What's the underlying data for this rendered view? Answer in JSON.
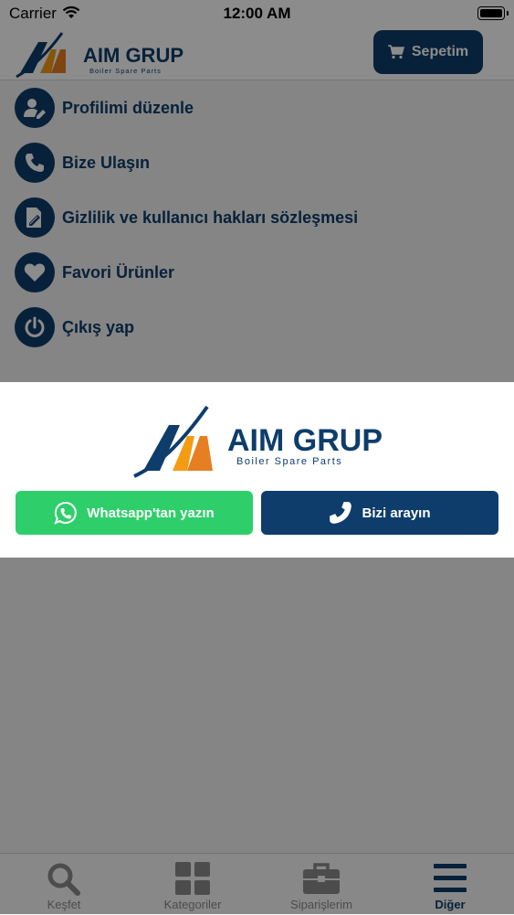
{
  "status_bar": {
    "carrier": "Carrier",
    "time": "12:00 AM"
  },
  "brand": {
    "name": "AIM GRUP",
    "tagline": "Boiler Spare Parts",
    "primary_color": "#0e3d6b",
    "accent_orange": "#f39c12"
  },
  "header": {
    "cart_label": "Sepetim",
    "cart_icon": "cart-icon"
  },
  "menu": {
    "items": [
      {
        "label": "Profilimi düzenle",
        "icon": "user-edit-icon"
      },
      {
        "label": "Bize Ulaşın",
        "icon": "phone-icon"
      },
      {
        "label": "Gizlilik ve kullanıcı hakları sözleşmesi",
        "icon": "document-edit-icon"
      },
      {
        "label": "Favori Ürünler",
        "icon": "heart-icon"
      },
      {
        "label": "Çıkış yap",
        "icon": "power-icon"
      }
    ]
  },
  "modal": {
    "whatsapp_label": "Whatsapp'tan yazın",
    "whatsapp_color": "#2ecf6a",
    "call_label": "Bizi arayın",
    "call_color": "#0e3d6b"
  },
  "tabbar": {
    "tabs": [
      {
        "label": "Keşfet",
        "icon": "search-icon"
      },
      {
        "label": "Kategoriler",
        "icon": "grid-icon"
      },
      {
        "label": "Siparişlerim",
        "icon": "briefcase-icon"
      },
      {
        "label": "Diğer",
        "icon": "menu-icon",
        "active": true
      }
    ]
  }
}
